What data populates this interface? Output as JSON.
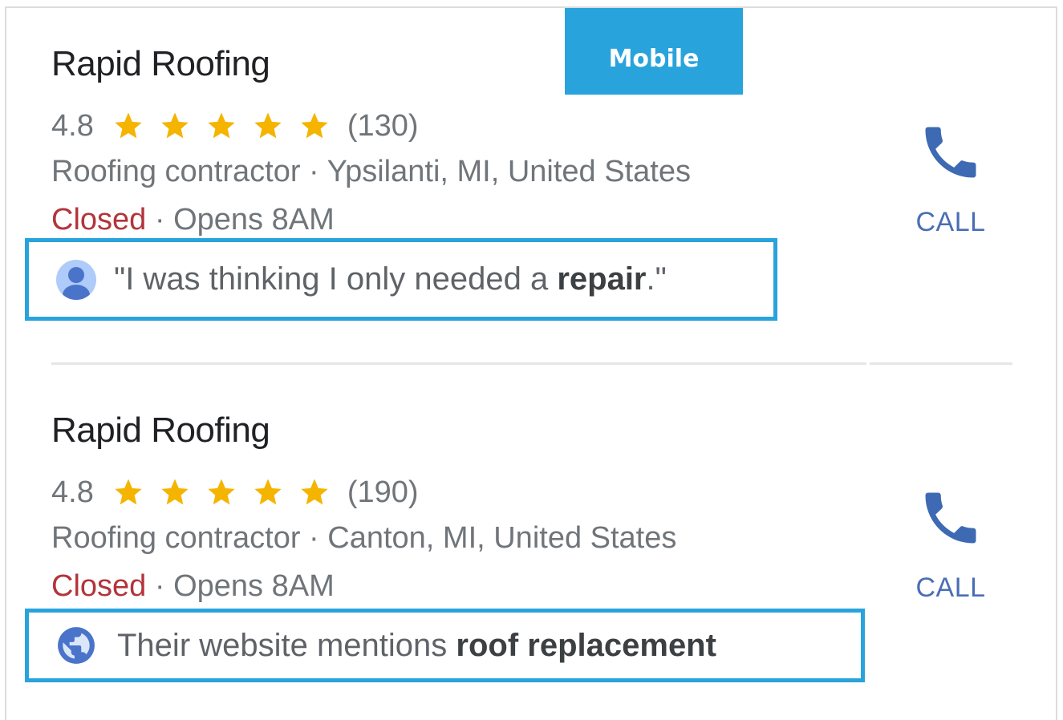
{
  "badge": {
    "label": "Mobile"
  },
  "listings": [
    {
      "name": "Rapid Roofing",
      "rating": "4.8",
      "stars": 5,
      "review_count": "(130)",
      "category_location": "Roofing contractor · Ypsilanti, MI, United States",
      "status": "Closed",
      "hours": " · Opens 8AM",
      "snippet_icon": "person-avatar-icon",
      "snippet_prefix": "\"I was thinking I only needed a ",
      "snippet_bold": "repair",
      "snippet_suffix": ".\"",
      "call_label": "CALL"
    },
    {
      "name": "Rapid Roofing",
      "rating": "4.8",
      "stars": 5,
      "review_count": "(190)",
      "category_location": "Roofing contractor · Canton, MI, United States",
      "status": "Closed",
      "hours": " · Opens 8AM",
      "snippet_icon": "globe-icon",
      "snippet_prefix": "Their website mentions ",
      "snippet_bold": "roof replacement",
      "snippet_suffix": "",
      "call_label": "CALL"
    }
  ],
  "colors": {
    "badge": "#29a3dc",
    "highlight_border": "#29a3dc",
    "star": "#f4b400",
    "closed": "#b3343a",
    "call": "#4a6eb5"
  }
}
